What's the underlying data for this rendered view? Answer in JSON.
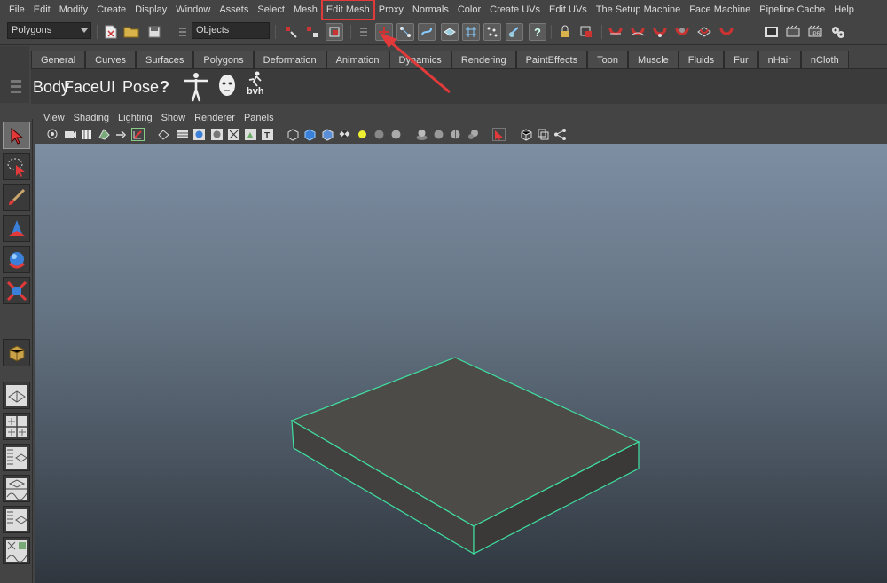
{
  "menubar": {
    "items": [
      "File",
      "Edit",
      "Modify",
      "Create",
      "Display",
      "Window",
      "Assets",
      "Select",
      "Mesh",
      "Edit Mesh",
      "Proxy",
      "Normals",
      "Color",
      "Create UVs",
      "Edit UVs",
      "The Setup Machine",
      "Face Machine",
      "Pipeline Cache",
      "Help"
    ],
    "highlighted": "Edit Mesh",
    "highlight_color": "#e23a3a"
  },
  "statusline": {
    "mode_selector": "Polygons",
    "selection_mask_field": "Objects"
  },
  "shelf": {
    "tabs": [
      "General",
      "Curves",
      "Surfaces",
      "Polygons",
      "Deformation",
      "Animation",
      "Dynamics",
      "Rendering",
      "PaintEffects",
      "Toon",
      "Muscle",
      "Fluids",
      "Fur",
      "nHair",
      "nCloth"
    ],
    "buttons": [
      "Body",
      "Face",
      "UI",
      "Pose",
      "?"
    ],
    "bvh_label": "bvh"
  },
  "panel": {
    "menus": [
      "View",
      "Shading",
      "Lighting",
      "Show",
      "Renderer",
      "Panels"
    ]
  },
  "viewport": {
    "object": "poly-cube",
    "wireframe_color": "#3fe0a0",
    "face_color": "#4d4b48",
    "background_top": "#7d8ea3",
    "background_bottom": "#2f363e"
  },
  "colors": {
    "ui_bg": "#444444",
    "text": "#dcdcdc",
    "annotation_red": "#e23a3a"
  }
}
